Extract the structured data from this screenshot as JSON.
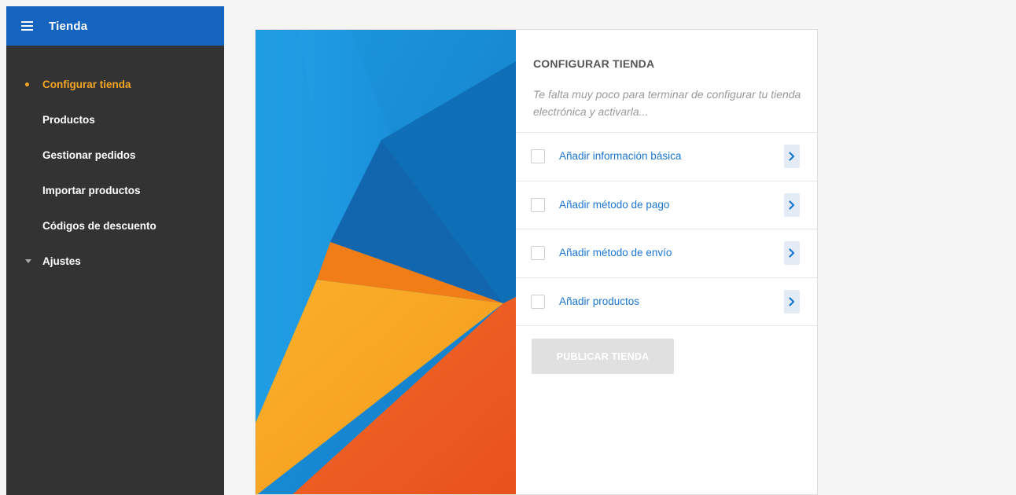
{
  "sidebar": {
    "title": "Tienda",
    "menu_icon": "hamburger-icon",
    "items": [
      {
        "label": "Configurar tienda",
        "active": true
      },
      {
        "label": "Productos"
      },
      {
        "label": "Gestionar pedidos"
      },
      {
        "label": "Importar productos"
      },
      {
        "label": "Códigos de descuento"
      },
      {
        "label": "Ajustes",
        "icon": "caret-down-icon"
      }
    ]
  },
  "setup": {
    "title": "CONFIGURAR TIENDA",
    "description": "Te falta muy poco para terminar de configurar tu tienda electrónica y activarla...",
    "tasks": [
      {
        "label": "Añadir información básica",
        "checked": false
      },
      {
        "label": "Añadir método de pago",
        "checked": false
      },
      {
        "label": "Añadir método de envío",
        "checked": false
      },
      {
        "label": "Añadir productos",
        "checked": false
      }
    ],
    "publish_label": "PUBLICAR TIENDA",
    "publish_enabled": false
  },
  "colors": {
    "header_blue": "#1565c0",
    "sidebar_bg": "#333333",
    "active_orange": "#f5a623",
    "link_blue": "#1976d2"
  }
}
